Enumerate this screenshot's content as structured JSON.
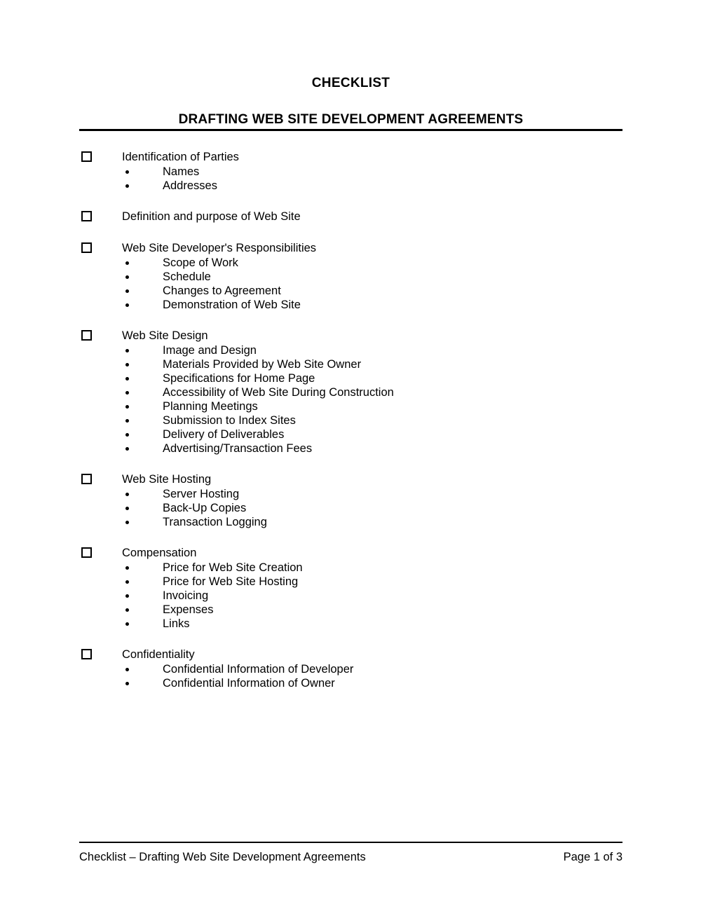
{
  "document": {
    "title": "CHECKLIST",
    "subtitle": "DRAFTING WEB SITE DEVELOPMENT AGREEMENTS"
  },
  "sections": [
    {
      "title": "Identification of Parties",
      "items": [
        "Names",
        "Addresses"
      ]
    },
    {
      "title": "Definition and purpose of Web Site",
      "items": []
    },
    {
      "title": "Web Site Developer's Responsibilities",
      "items": [
        "Scope of Work",
        "Schedule",
        "Changes to Agreement",
        "Demonstration of Web Site"
      ]
    },
    {
      "title": "Web Site Design",
      "items": [
        "Image and Design",
        "Materials Provided by Web Site Owner",
        "Specifications for Home Page",
        "Accessibility of Web Site During Construction",
        "Planning Meetings",
        "Submission to Index Sites",
        "Delivery of Deliverables",
        "Advertising/Transaction Fees"
      ]
    },
    {
      "title": "Web Site Hosting",
      "items": [
        "Server Hosting",
        "Back-Up Copies",
        "Transaction Logging"
      ]
    },
    {
      "title": "Compensation",
      "items": [
        "Price for Web Site Creation",
        "Price for Web Site Hosting",
        "Invoicing",
        "Expenses",
        "Links"
      ]
    },
    {
      "title": "Confidentiality",
      "items": [
        "Confidential Information of Developer",
        "Confidential Information of Owner"
      ]
    }
  ],
  "footer": {
    "caption": "Checklist – Drafting Web Site Development Agreements",
    "page_label": "Page 1 of 3"
  }
}
